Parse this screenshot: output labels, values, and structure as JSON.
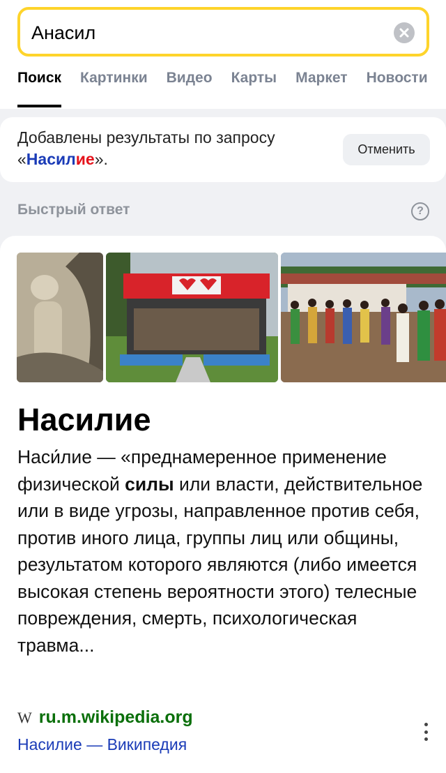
{
  "search": {
    "query": "Анасил"
  },
  "tabs": [
    {
      "label": "Поиск",
      "active": true
    },
    {
      "label": "Картинки"
    },
    {
      "label": "Видео"
    },
    {
      "label": "Карты"
    },
    {
      "label": "Маркет"
    },
    {
      "label": "Новости"
    }
  ],
  "notice": {
    "prefix": "Добавлены результаты по запросу",
    "open_quote": "«",
    "query_part1": "Насил",
    "query_part2": "ие",
    "close_quote": "».",
    "cancel_label": "Отменить"
  },
  "quick_answer": {
    "label": "Быстрый ответ",
    "help_glyph": "?"
  },
  "result": {
    "title": "Насилие",
    "desc_part1": "Наси́лие — «преднамеренное применение физической ",
    "desc_bold": "силы",
    "desc_part2": " или власти, действительное или в виде угрозы, направленное против себя, против иного лица, группы лиц или общины, результатом которого являются (либо имеется высокая степень вероятности этого) телесные повреждения, смерть, психологическая травма...",
    "source_icon": "W",
    "source_domain": "ru.m.wikipedia.org",
    "source_link": "Насилие — Википедия"
  },
  "colors": {
    "accent_yellow": "#fed42b",
    "link_blue": "#1a3bb7",
    "query_red": "#e5131c",
    "domain_green": "#0a6f0a"
  }
}
